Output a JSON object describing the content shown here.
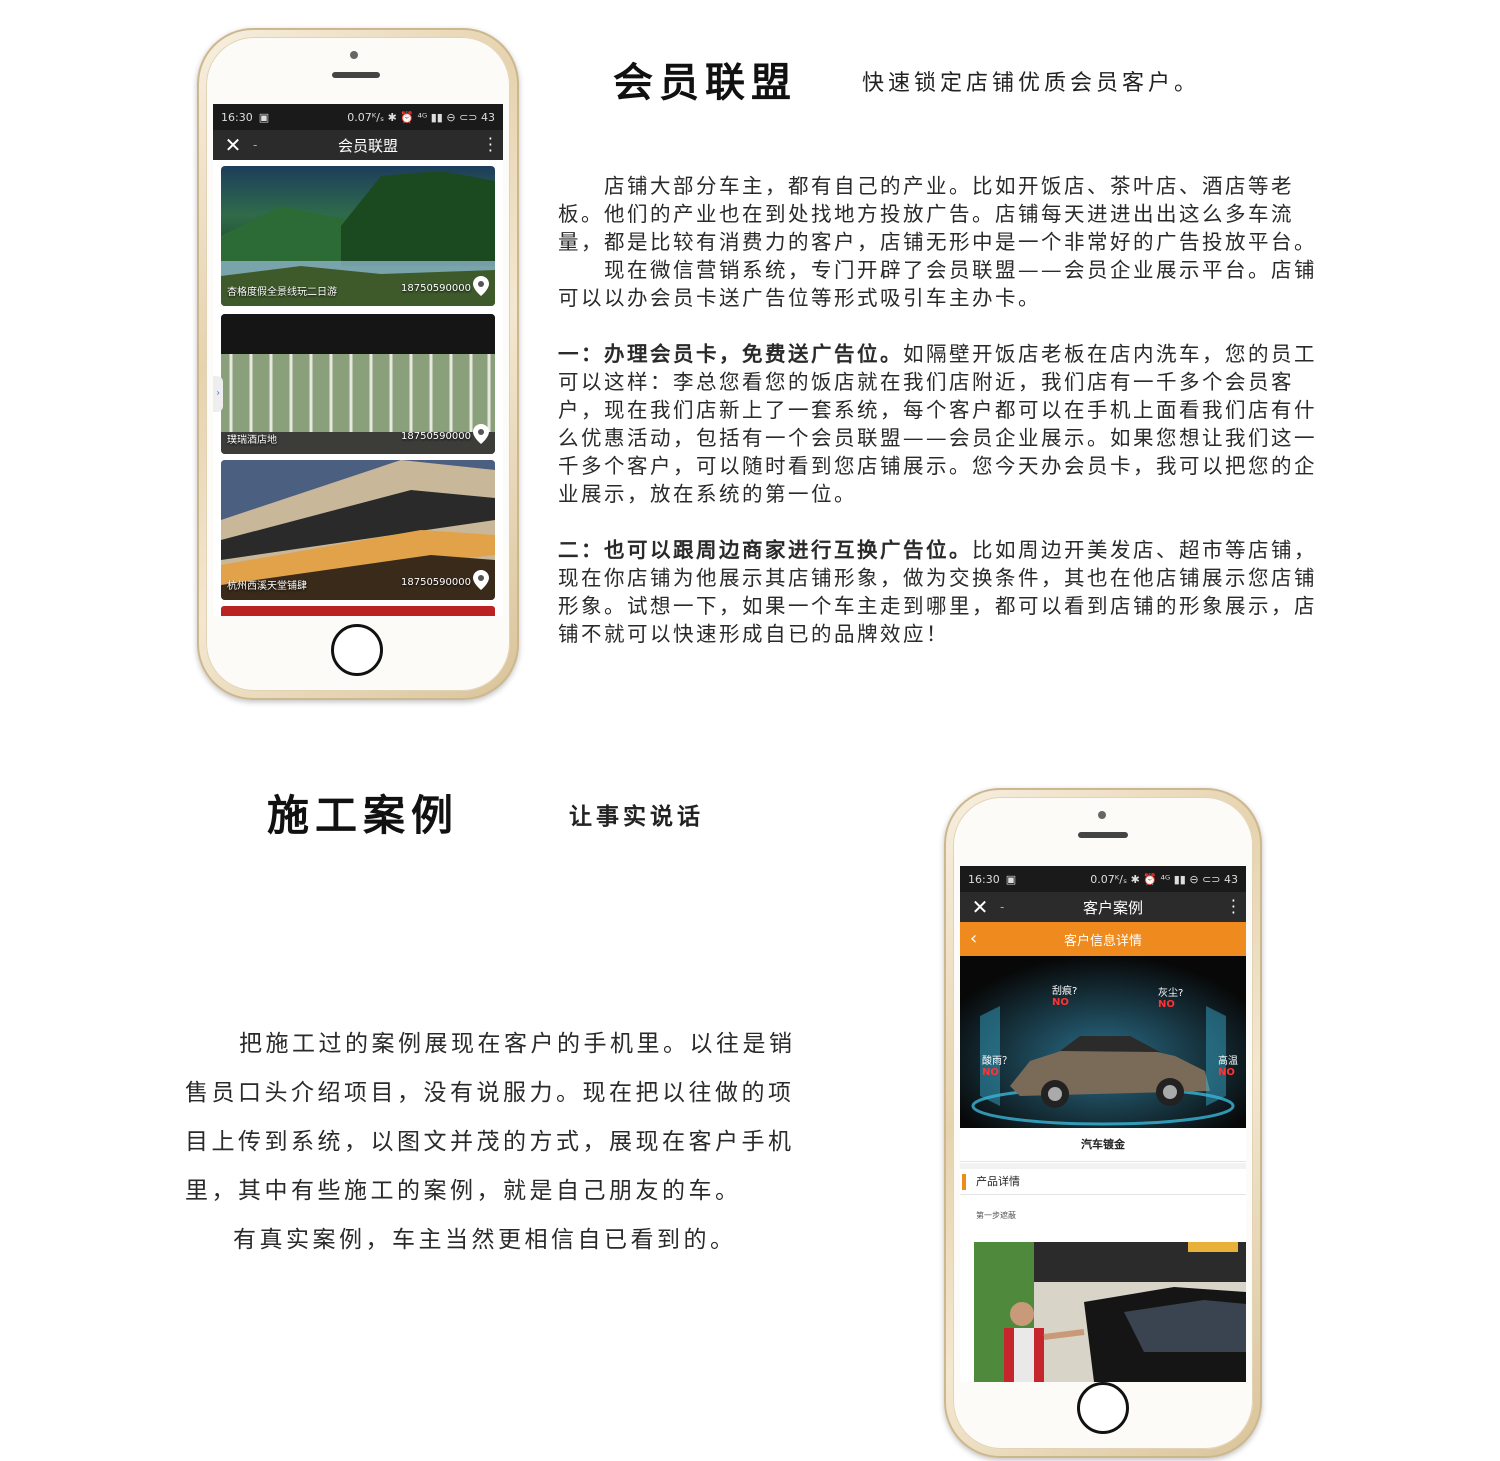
{
  "section1": {
    "title": "会员联盟",
    "subtitle": "快速锁定店铺优质会员客户。",
    "para1": "店铺大部分车主，都有自己的产业。比如开饭店、茶叶店、酒店等老板。他们的产业也在到处找地方投放广告。店铺每天进进出出这么多车流量，都是比较有消费力的客户，店铺无形中是一个非常好的广告投放平台。",
    "para2": "现在微信营销系统，专门开辟了会员联盟——会员企业展示平台。店铺可以以办会员卡送广告位等形式吸引车主办卡。",
    "item1_bold": "一：办理会员卡，免费送广告位。",
    "item1_text": "如隔壁开饭店老板在店内洗车，您的员工可以这样：李总您看您的饭店就在我们店附近，我们店有一千多个会员客户，现在我们店新上了一套系统，每个客户都可以在手机上面看我们店有什么优惠活动，包括有一个会员联盟——会员企业展示。如果您想让我们这一千多个客户，可以随时看到您店铺展示。您今天办会员卡，我可以把您的企业展示，放在系统的第一位。",
    "item2_bold": "二：也可以跟周边商家进行互换广告位。",
    "item2_text": "比如周边开美发店、超市等店铺，现在你店铺为他展示其店铺形象，做为交换条件，其也在他店铺展示您店铺形象。试想一下，如果一个车主走到哪里，都可以看到店铺的形象展示，店铺不就可以快速形成自已的品牌效应！"
  },
  "section2": {
    "title": "施工案例",
    "subtitle": "让事实说话",
    "para1": "把施工过的案例展现在客户的手机里。以往是销售员口头介绍项目，没有说服力。现在把以往做的项目上传到系统，以图文并茂的方式，展现在客户手机里，其中有些施工的案例，就是自己朋友的车。",
    "para2": "有真实案例，车主当然更相信自已看到的。"
  },
  "phone1": {
    "time": "16:30",
    "status_right": "0.07ᴷ/ₛ ✱ ⏰ ⁴ᴳ ▮▮ ⊖ ⊂⊃ 43",
    "nav_title": "会员联盟",
    "cards": [
      {
        "name": "杏格度假全景线玩二日游",
        "phone": "18750590000"
      },
      {
        "name": "璞瑞酒店地",
        "phone": "18750590000"
      },
      {
        "name": "杭州西溪天堂铺肆",
        "phone": "18750590000"
      }
    ]
  },
  "phone2": {
    "time": "16:30",
    "status_right": "0.07ᴷ/ₛ ✱ ⏰ ⁴ᴳ ▮▮ ⊖ ⊂⊃ 43",
    "nav_title": "客户案例",
    "orange_title": "客户信息详情",
    "tags": [
      "刮痕?",
      "灰尘?",
      "酸雨？",
      "高温"
    ],
    "tag_no": "NO",
    "product_title": "汽车镀金",
    "section_label": "产品详情",
    "step_label": "第一步遮蔽"
  }
}
